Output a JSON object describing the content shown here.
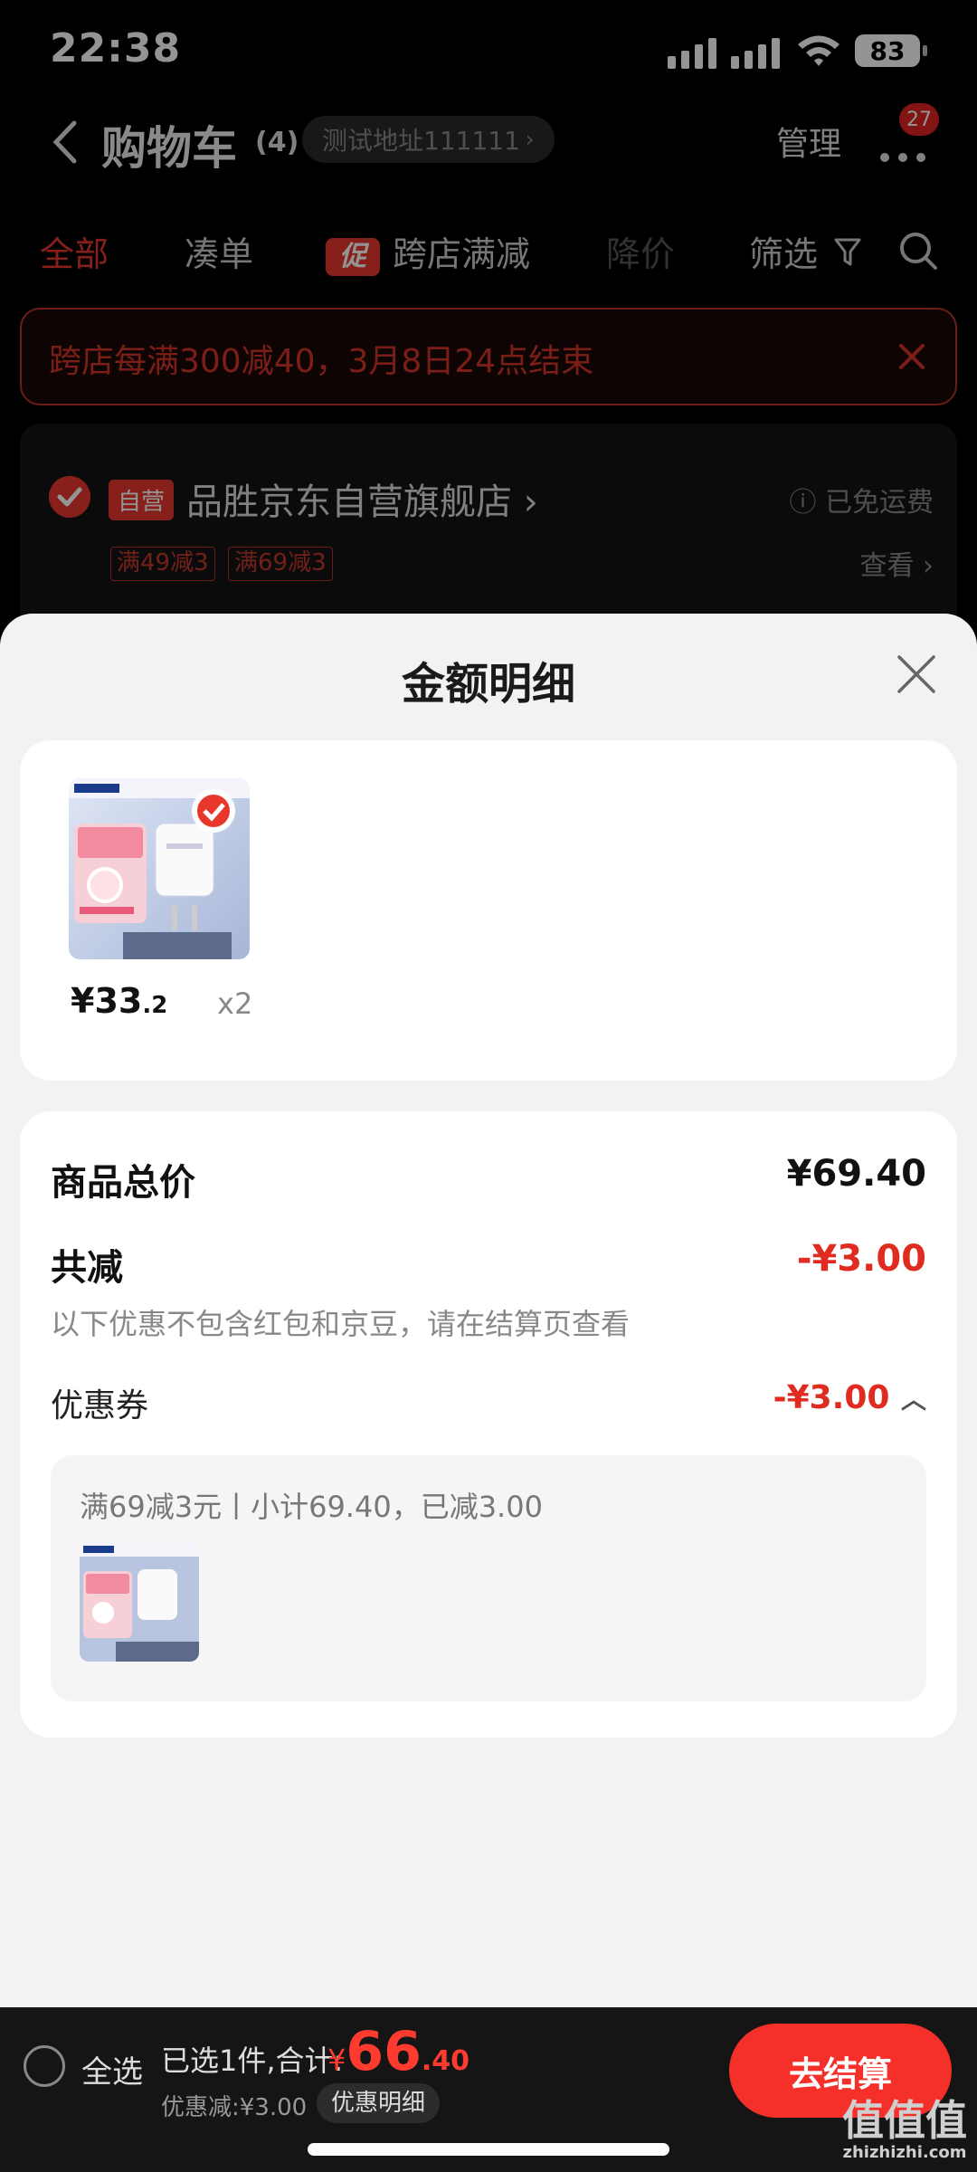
{
  "status": {
    "time": "22:38",
    "battery": "83"
  },
  "header": {
    "title": "购物车",
    "count": "(4)",
    "address": "测试地址111111",
    "manage": "管理",
    "badge": "27"
  },
  "tabs": {
    "all": "全部",
    "combine": "凑单",
    "promo_tag": "促",
    "cross_store": "跨店满减",
    "price_drop": "降价",
    "filter": "筛选"
  },
  "banner": {
    "text": "跨店每满300减40，3月8日24点结束"
  },
  "store": {
    "self_tag": "自营",
    "name": "品胜京东自营旗舰店",
    "shipping": "已免运费",
    "coupons": [
      "满49减3",
      "满69减3"
    ],
    "view": "查看"
  },
  "sheet": {
    "title": "金额明细",
    "product": {
      "price_main": "¥33",
      "price_dec": ".2",
      "qty": "x2"
    },
    "total_label": "商品总价",
    "total_value": "¥69.40",
    "reduce_label": "共减",
    "reduce_value": "-¥3.00",
    "reduce_note": "以下优惠不包含红包和京豆，请在结算页查看",
    "coupon_label": "优惠券",
    "coupon_value": "-¥3.00",
    "coupon_desc": "满69减3元丨小计69.40，已减3.00"
  },
  "bottom": {
    "select_all": "全选",
    "selected_info": "已选1件,合计:",
    "total_currency": "¥",
    "total_int": "66",
    "total_dec": ".40",
    "saved": "优惠减:¥3.00",
    "detail_button": "优惠明细",
    "checkout": "去结算"
  },
  "watermark": {
    "main": "值值值",
    "sub": "zhizhizhi.com"
  },
  "colors": {
    "accent": "#e8382d",
    "price_red": "#e02b20",
    "sheet_bg": "#f2f2f2"
  }
}
